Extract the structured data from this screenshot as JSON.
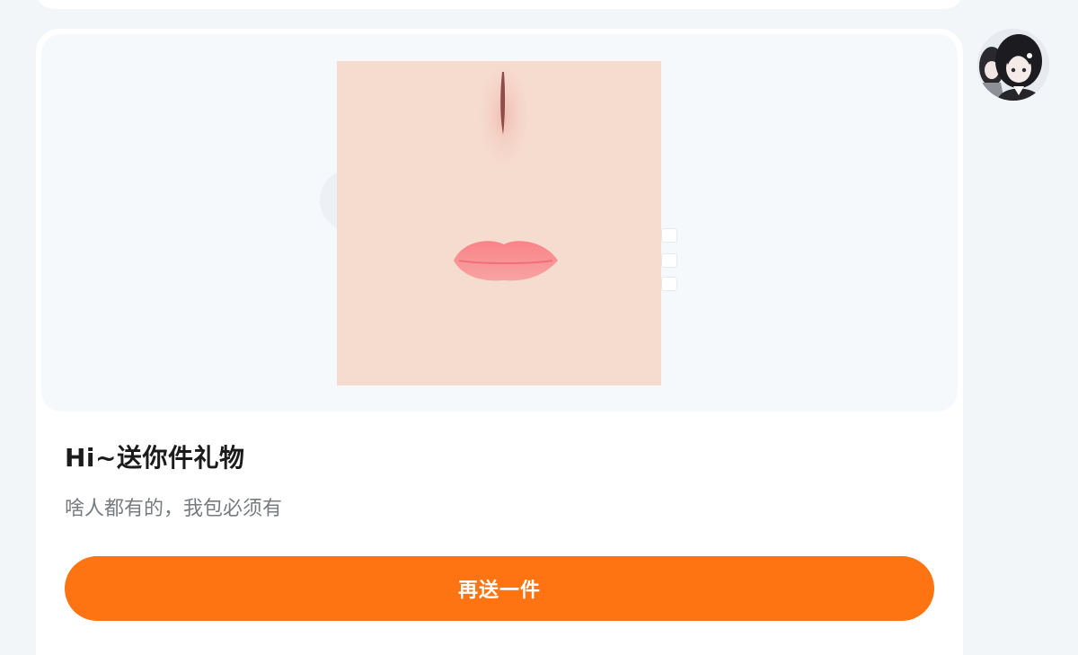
{
  "message": {
    "title": "Hi~送你件礼物",
    "description": "啥人都有的，我包必须有",
    "action_label": "再送一件",
    "gift_image_icon": "face-nose-lips-image",
    "avatar_icon": "anime-avatar"
  },
  "colors": {
    "accent": "#ff7412",
    "page_background": "#f3f6f9",
    "skin": "#f6dccf",
    "lips": "#f68c8e"
  }
}
